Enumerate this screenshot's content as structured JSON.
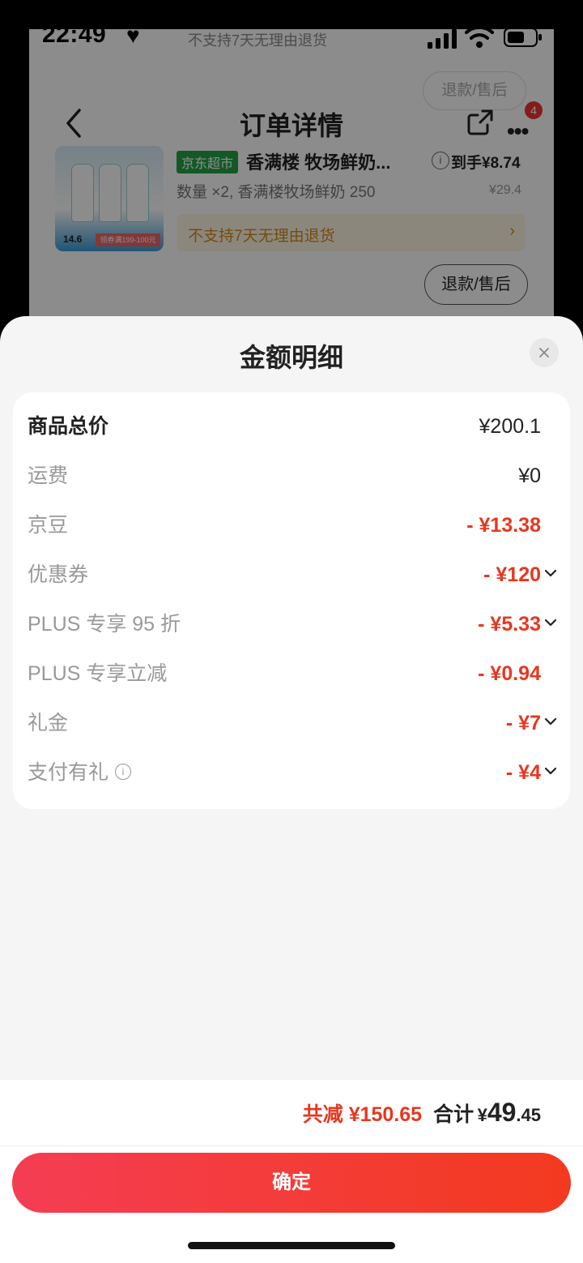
{
  "status_bar": {
    "time": "22:49",
    "background_note": "不支持7天无理由退货"
  },
  "background": {
    "top_refund_label": "退款/售后",
    "nav": {
      "title": "订单详情",
      "more_badge": "4"
    },
    "product": {
      "image_price": "14.6",
      "image_strip": "领券满199-100元",
      "store_tag": "京东超市",
      "name": "香满楼 牧场鲜奶...",
      "final_price_label": "到手¥8.74",
      "spec": "数量 ×2, 香满楼牧场鲜奶 250",
      "original_price": "¥29.4",
      "no_return_notice": "不支持7天无理由退货",
      "refund_button": "退款/售后"
    }
  },
  "sheet": {
    "title": "金额明细",
    "rows": [
      {
        "label": "商品总价",
        "value": "¥200.1"
      },
      {
        "label": "运费",
        "value": "¥0"
      },
      {
        "label": "京豆",
        "value": "- ¥13.38"
      },
      {
        "label": "优惠券",
        "value": "- ¥120"
      },
      {
        "label": "PLUS 专享 95 折",
        "value": "- ¥5.33"
      },
      {
        "label": "PLUS 专享立减",
        "value": "- ¥0.94"
      },
      {
        "label": "礼金",
        "value": "- ¥7"
      },
      {
        "label": "支付有礼",
        "value": "- ¥4"
      }
    ],
    "footer": {
      "saved": "共减 ¥150.65",
      "total_label": "合计",
      "total_currency": "¥",
      "total_int": "49",
      "total_dec": ".45",
      "confirm": "确定"
    }
  },
  "colors": {
    "accent_red": "#e8371f",
    "store_green": "#23a24a",
    "notice_orange": "#d28a1a"
  }
}
